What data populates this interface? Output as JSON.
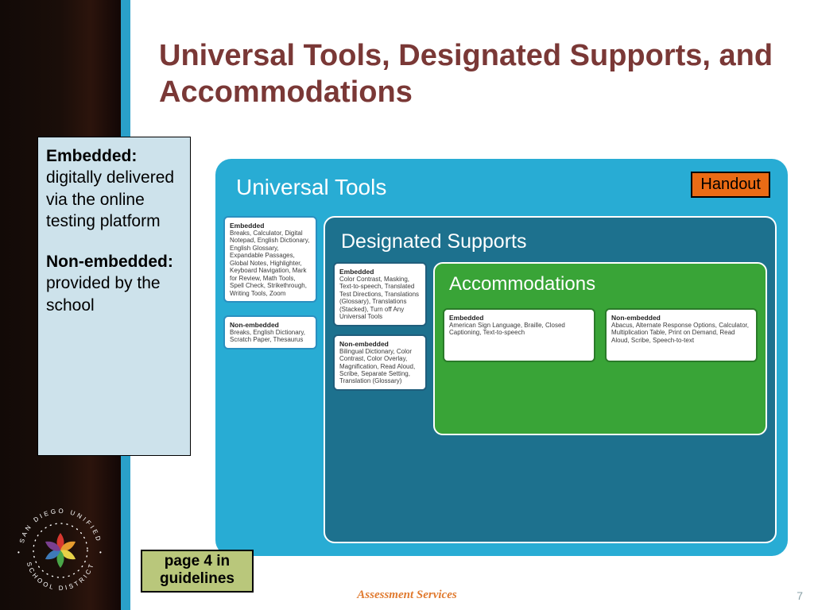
{
  "title": "Universal Tools, Designated Supports, and Accommodations",
  "definitions": {
    "embedded": {
      "heading": "Embedded:",
      "body": "digitally delivered via the online testing platform"
    },
    "nonembedded": {
      "heading": "Non-embedded:",
      "body": "provided by the school"
    }
  },
  "handout_label": "Handout",
  "diagram": {
    "ut_label": "Universal Tools",
    "ut_embedded": {
      "title": "Embedded",
      "body": "Breaks, Calculator, Digital Notepad, English Dictionary, English Glossary, Expandable Passages, Global Notes, Highlighter, Keyboard Navigation, Mark for Review, Math Tools, Spell Check, Strikethrough, Writing Tools, Zoom"
    },
    "ut_nonembedded": {
      "title": "Non-embedded",
      "body": "Breaks, English Dictionary, Scratch Paper, Thesaurus"
    },
    "ds_label": "Designated Supports",
    "ds_embedded": {
      "title": "Embedded",
      "body": "Color Contrast, Masking, Text-to-speech, Translated Test Directions, Translations (Glossary), Translations (Stacked), Turn off Any Universal Tools"
    },
    "ds_nonembedded": {
      "title": "Non-embedded",
      "body": "Bilingual Dictionary, Color Contrast, Color Overlay, Magnification, Read Aloud, Scribe, Separate Setting, Translation (Glossary)"
    },
    "acc_label": "Accommodations",
    "acc_embedded": {
      "title": "Embedded",
      "body": "American Sign Language, Braille, Closed Captioning, Text-to-speech"
    },
    "acc_nonembedded": {
      "title": "Non-embedded",
      "body": "Abacus, Alternate Response Options, Calculator, Multiplication Table, Print on Demand, Read Aloud, Scribe, Speech-to-text"
    }
  },
  "pagenote": {
    "line1": "page 4 in",
    "line2": "guidelines"
  },
  "footer": {
    "assessment": "Assessment Services",
    "pageno": "7"
  },
  "logo": {
    "top": "SAN DIEGO UNIFIED",
    "bottom": "SCHOOL DISTRICT"
  }
}
